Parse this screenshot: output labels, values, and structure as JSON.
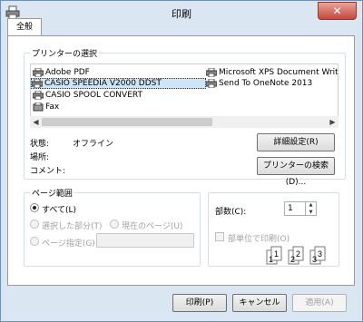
{
  "window": {
    "title": "印刷",
    "close_symbol": "✕"
  },
  "tabs": [
    {
      "label": "全般"
    }
  ],
  "printer_select": {
    "group_label": "プリンターの選択",
    "printers": [
      {
        "name": "Adobe PDF"
      },
      {
        "name": "CASIO SPEEDIA V2000 DDST",
        "selected": true
      },
      {
        "name": "CASIO SPOOL CONVERT"
      },
      {
        "name": "Fax"
      },
      {
        "name": "Microsoft XPS Document Write"
      },
      {
        "name": "Send To OneNote 2013"
      }
    ],
    "status_label": "状態:",
    "status_value": "オフライン",
    "location_label": "場所:",
    "comment_label": "コメント:",
    "preferences_button": "詳細設定(R)",
    "find_button": "プリンターの検索(D)..."
  },
  "page_range": {
    "group_label": "ページ範囲",
    "all": "すべて(L)",
    "selection": "選択した部分(T)",
    "current_page": "現在のページ(U)",
    "pages": "ページ指定(G):",
    "pages_value": ""
  },
  "copies": {
    "label": "部数(C):",
    "value": "1",
    "collate_label": "部単位で印刷(O)",
    "collate_pages": [
      "1",
      "1",
      "2",
      "2",
      "3",
      "3"
    ]
  },
  "footer": {
    "print": "印刷(P)",
    "cancel": "キャンセル",
    "apply": "適用(A)"
  },
  "colors": {
    "accent": "#cde5f7",
    "close": "#c7463b",
    "frame": "#dbe6f3"
  }
}
